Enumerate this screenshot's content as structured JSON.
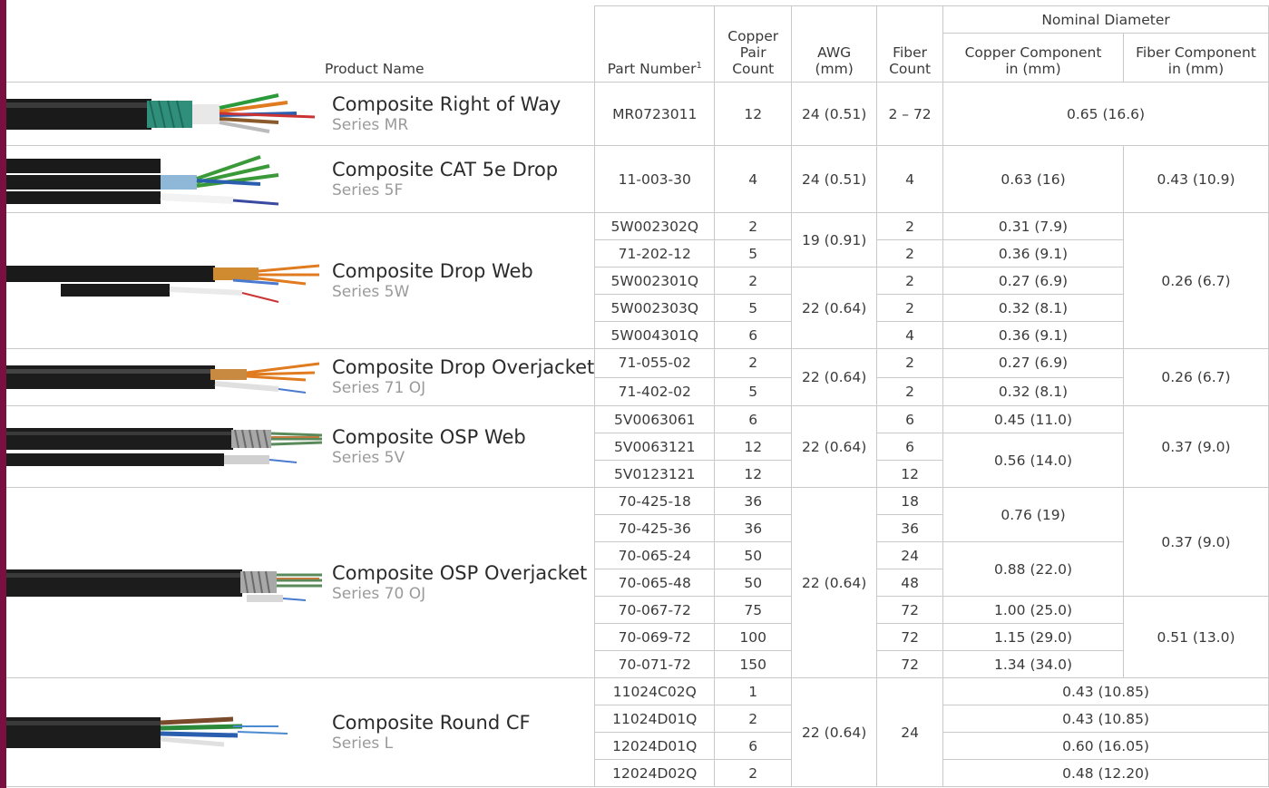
{
  "header": {
    "product_name": "Product Name",
    "part_number": "Part Number",
    "part_number_footnote": "1",
    "copper_pair_count": "Copper Pair Count",
    "awg": "AWG (mm)",
    "fiber_count": "Fiber Count",
    "nominal_diameter": "Nominal Diameter",
    "copper_component": "Copper Component in (mm)",
    "fiber_component": "Fiber Component in (mm)"
  },
  "products": [
    {
      "name": "Composite Right of Way",
      "series": "Series MR"
    },
    {
      "name": "Composite CAT 5e Drop",
      "series": "Series 5F"
    },
    {
      "name": "Composite Drop Web",
      "series": "Series 5W"
    },
    {
      "name": "Composite Drop Overjacket",
      "series": "Series 71 OJ"
    },
    {
      "name": "Composite OSP Web",
      "series": "Series 5V"
    },
    {
      "name": "Composite OSP Overjacket",
      "series": "Series 70 OJ"
    },
    {
      "name": "Composite Round CF",
      "series": "Series L"
    }
  ],
  "rows": {
    "mr": {
      "part": "MR0723011",
      "pairs": "12",
      "awg": "24 (0.51)",
      "fiber": "2 – 72",
      "diameter": "0.65 (16.6)"
    },
    "f5": {
      "part": "11-003-30",
      "pairs": "4",
      "awg": "24 (0.51)",
      "fiber": "4",
      "copper": "0.63 (16)",
      "fiber_d": "0.43 (10.9)"
    },
    "w5": {
      "parts": [
        "5W002302Q",
        "71-202-12",
        "5W002301Q",
        "5W002303Q",
        "5W004301Q"
      ],
      "pairs": [
        "2",
        "5",
        "2",
        "5",
        "6"
      ],
      "awg": [
        "19 (0.91)",
        "22 (0.64)"
      ],
      "fiber": [
        "2",
        "2",
        "2",
        "2",
        "4"
      ],
      "copper": [
        "0.31 (7.9)",
        "0.36 (9.1)",
        "0.27 (6.9)",
        "0.32 (8.1)",
        "0.36 (9.1)"
      ],
      "fiber_d": "0.26 (6.7)"
    },
    "oj71": {
      "parts": [
        "71-055-02",
        "71-402-02"
      ],
      "pairs": [
        "2",
        "5"
      ],
      "awg": "22 (0.64)",
      "fiber": [
        "2",
        "2"
      ],
      "copper": [
        "0.27 (6.9)",
        "0.32 (8.1)"
      ],
      "fiber_d": "0.26 (6.7)"
    },
    "v5": {
      "parts": [
        "5V0063061",
        "5V0063121",
        "5V0123121"
      ],
      "pairs": [
        "6",
        "12",
        "12"
      ],
      "awg": "22 (0.64)",
      "fiber": [
        "6",
        "6",
        "12"
      ],
      "copper": [
        "0.45 (11.0)",
        "0.56 (14.0)"
      ],
      "fiber_d": "0.37 (9.0)"
    },
    "oj70": {
      "parts": [
        "70-425-18",
        "70-425-36",
        "70-065-24",
        "70-065-48",
        "70-067-72",
        "70-069-72",
        "70-071-72"
      ],
      "pairs": [
        "36",
        "36",
        "50",
        "50",
        "75",
        "100",
        "150"
      ],
      "awg": "22 (0.64)",
      "fiber": [
        "18",
        "36",
        "24",
        "48",
        "72",
        "72",
        "72"
      ],
      "copper": [
        "0.76 (19)",
        "0.88 (22.0)",
        "1.00 (25.0)",
        "1.15 (29.0)",
        "1.34 (34.0)"
      ],
      "fiber_d": [
        "0.37 (9.0)",
        "0.51 (13.0)"
      ]
    },
    "l": {
      "parts": [
        "11024C02Q",
        "11024D01Q",
        "12024D01Q",
        "12024D02Q"
      ],
      "pairs": [
        "1",
        "2",
        "6",
        "2"
      ],
      "awg": "22 (0.64)",
      "fiber": "24",
      "diameter": [
        "0.43 (10.85)",
        "0.43 (10.85)",
        "0.60 (16.05)",
        "0.48 (12.20)"
      ]
    }
  },
  "colors": {
    "accent": "#7a1040",
    "border": "#c9c9c9",
    "text": "#3a3a3a",
    "series_text": "#9a9a9a"
  },
  "cable_images": [
    "cable-right-of-way",
    "cable-cat5e-drop",
    "cable-drop-web",
    "cable-drop-overjacket",
    "cable-osp-web",
    "cable-osp-overjacket",
    "cable-round-cf"
  ]
}
